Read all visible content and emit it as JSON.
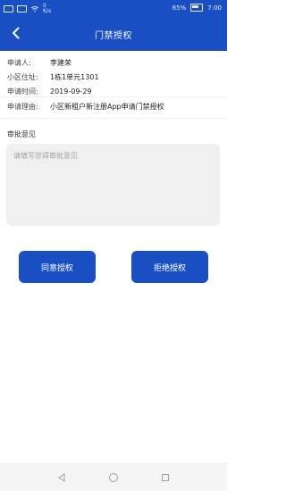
{
  "status_bar": {
    "speed": "0\nK/s",
    "battery_percent": "65%",
    "time": "7:00"
  },
  "header": {
    "title": "门禁授权",
    "back_icon": "chevron-left-icon"
  },
  "application": {
    "applicant_label": "申请人:",
    "applicant_value": "李建荣",
    "address_label": "小区住址:",
    "address_value": "1栋1单元1301",
    "time_label": "申请时间:",
    "time_value": "2019-09-29",
    "reason_label": "申请理由:",
    "reason_value": "小区新租户新注册App申请门禁授权"
  },
  "approval": {
    "title": "审批意见",
    "placeholder": "请填写您得审批意见"
  },
  "buttons": {
    "approve": "同意授权",
    "reject": "拒绝授权"
  },
  "colors": {
    "brand": "#1a4fc3",
    "background": "#ffffff",
    "input_bg": "#f0f0f0"
  }
}
